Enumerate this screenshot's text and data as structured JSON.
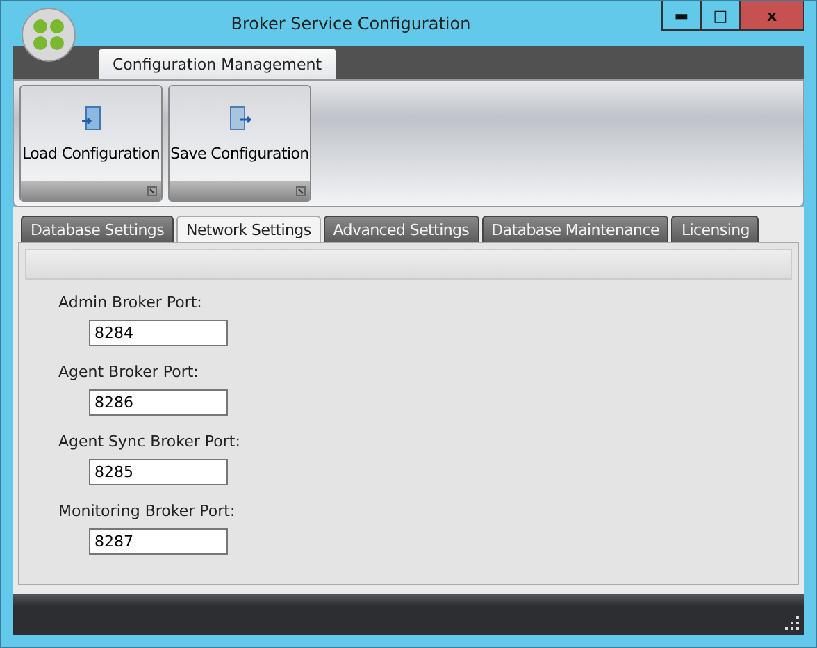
{
  "window": {
    "title": "Broker Service Configuration",
    "controls": [
      "▬",
      "□",
      "x"
    ]
  },
  "ribbon": {
    "tabs": [
      {
        "label": "Configuration Management",
        "selected": true
      }
    ],
    "buttons": [
      {
        "label": "Load Configuration",
        "kind": "load"
      },
      {
        "label": "Save Configuration",
        "kind": "save"
      }
    ]
  },
  "tabs": [
    {
      "label": "Database Settings",
      "selected": false
    },
    {
      "label": "Network Settings",
      "selected": true
    },
    {
      "label": "Advanced Settings",
      "selected": false
    },
    {
      "label": "Database Maintenance",
      "selected": false
    },
    {
      "label": "Licensing",
      "selected": false
    }
  ],
  "fields": [
    {
      "label": "Admin Broker Port:",
      "value": "8284"
    },
    {
      "label": "Agent Broker Port:",
      "value": "8286"
    },
    {
      "label": "Agent Sync Broker Port:",
      "value": "8285"
    },
    {
      "label": "Monitoring Broker Port:",
      "value": "8287"
    }
  ]
}
